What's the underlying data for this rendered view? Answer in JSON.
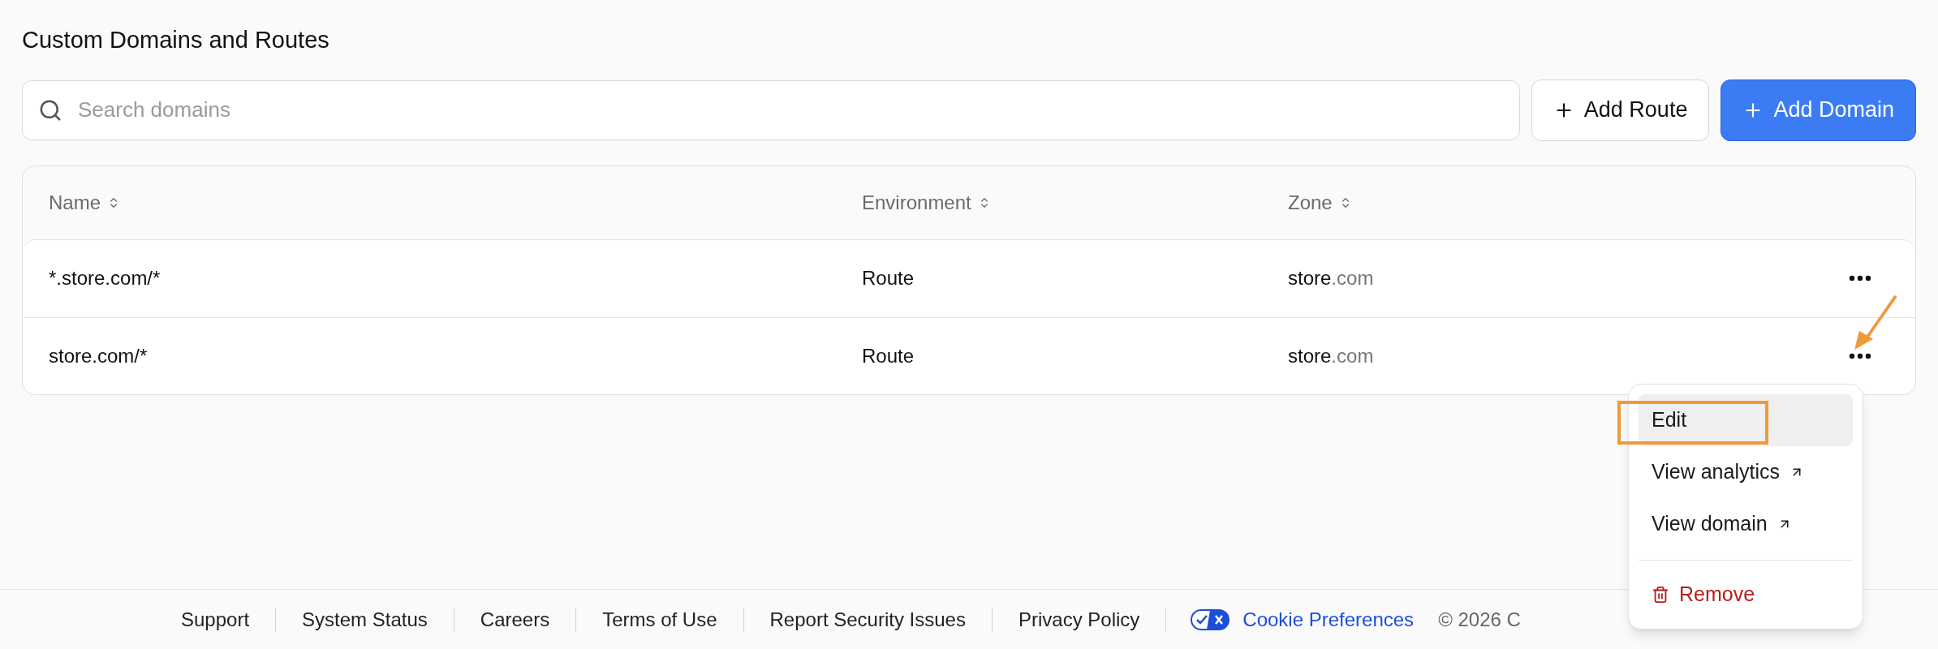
{
  "title": "Custom Domains and Routes",
  "search": {
    "placeholder": "Search domains"
  },
  "buttons": [
    {
      "label": "Add Route",
      "kind": "secondary"
    },
    {
      "label": "Add Domain",
      "kind": "primary"
    }
  ],
  "table": {
    "columns": [
      {
        "label": "Name"
      },
      {
        "label": "Environment"
      },
      {
        "label": "Zone"
      }
    ],
    "rows": [
      {
        "name": "*.store.com/*",
        "environment": "Route",
        "zone_host": "store",
        "zone_tld": ".com"
      },
      {
        "name": "store.com/*",
        "environment": "Route",
        "zone_host": "store",
        "zone_tld": ".com"
      }
    ]
  },
  "row_menu": {
    "items": [
      {
        "label": "Edit",
        "kind": "action",
        "selected": true
      },
      {
        "label": "View analytics",
        "kind": "external",
        "selected": false
      },
      {
        "label": "View domain",
        "kind": "external",
        "selected": false
      },
      {
        "label": "Remove",
        "kind": "danger",
        "selected": false
      }
    ]
  },
  "footer": {
    "links": [
      {
        "label": "Support"
      },
      {
        "label": "System Status"
      },
      {
        "label": "Careers"
      },
      {
        "label": "Terms of Use"
      },
      {
        "label": "Report Security Issues"
      },
      {
        "label": "Privacy Policy"
      }
    ],
    "cookie_link": "Cookie Preferences",
    "copyright": "© 2026 C"
  }
}
